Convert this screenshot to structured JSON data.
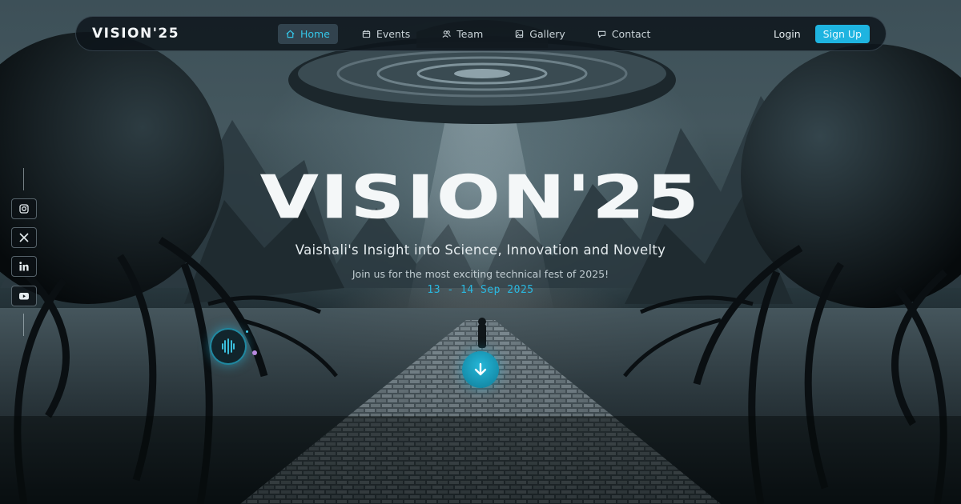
{
  "brand": {
    "logo": "VISION'25"
  },
  "nav": {
    "items": [
      {
        "label": "Home",
        "icon": "home-icon",
        "active": true
      },
      {
        "label": "Events",
        "icon": "calendar-icon",
        "active": false
      },
      {
        "label": "Team",
        "icon": "users-icon",
        "active": false
      },
      {
        "label": "Gallery",
        "icon": "image-icon",
        "active": false
      },
      {
        "label": "Contact",
        "icon": "chat-icon",
        "active": false
      }
    ],
    "login_label": "Login",
    "signup_label": "Sign Up"
  },
  "social": [
    "instagram-icon",
    "x-icon",
    "linkedin-icon",
    "youtube-icon"
  ],
  "hero": {
    "title": "VISION'25",
    "tagline": "Vaishali's Insight into Science, Innovation and Novelty",
    "subtitle": "Join us for the most exciting technical fest of 2025!",
    "date": "13 - 14 Sep 2025"
  },
  "colors": {
    "accent": "#1eb4e0",
    "active_nav": "#34c6e8",
    "background": "#0b1318"
  }
}
